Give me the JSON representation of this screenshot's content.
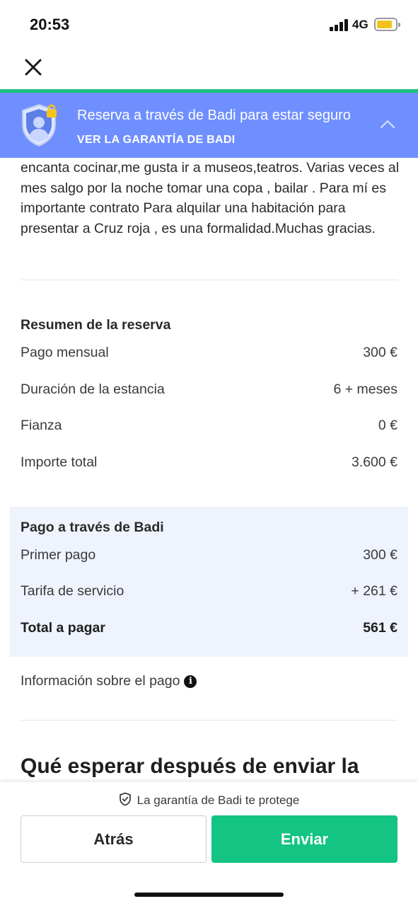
{
  "status_bar": {
    "time": "20:53",
    "network": "4G",
    "battery_color": "#f2c21b"
  },
  "nav": {
    "close_icon": "close-icon"
  },
  "banner": {
    "title": "Reserva a través de Badi para estar seguro",
    "link": "VER LA GARANTÍA DE BADI",
    "bg_color": "#6f8fff",
    "accent_line_color": "#19c37d"
  },
  "description": "encanta cocinar,me gusta ir a museos,teatros. Varias veces al mes salgo por la noche tomar una copa , bailar . Para mí es importante contrato Para alquilar una habitación para presentar a Cruz roja , es una formalidad.Muchas gracias.",
  "booking_summary": {
    "title": "Resumen de la reserva",
    "rows": [
      {
        "label": "Pago mensual",
        "value": "300 €"
      },
      {
        "label": "Duración de la estancia",
        "value": "6 + meses"
      },
      {
        "label": "Fianza",
        "value": "0 €"
      },
      {
        "label": "Importe total",
        "value": "3.600 €"
      }
    ]
  },
  "payment": {
    "title": "Pago a través de Badi",
    "rows": [
      {
        "label": "Primer pago",
        "value": "300 €"
      },
      {
        "label": "Tarifa de servicio",
        "value": "+ 261 €"
      }
    ],
    "total": {
      "label": "Total a pagar",
      "value": "561 €"
    },
    "bg_color": "#eef3fd"
  },
  "payment_info": {
    "label": "Información sobre el pago",
    "icon": "info-icon"
  },
  "next_steps_heading": "Qué esperar después de enviar la",
  "footer": {
    "guarantee": "La garantía de Badi te protege",
    "back_label": "Atrás",
    "send_label": "Enviar",
    "send_color": "#13c483"
  }
}
